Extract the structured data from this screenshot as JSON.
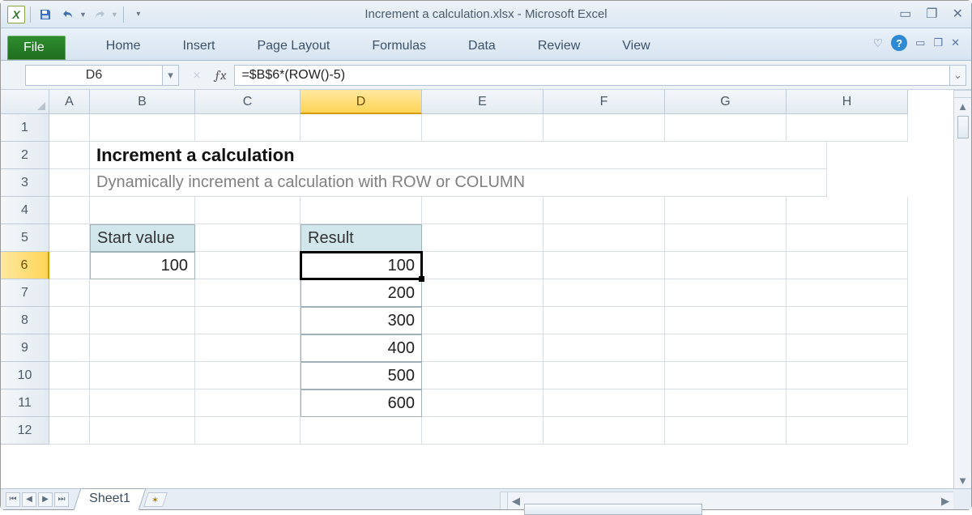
{
  "window": {
    "title": "Increment a calculation.xlsx  -  Microsoft Excel"
  },
  "ribbon": {
    "file": "File",
    "tabs": [
      "Home",
      "Insert",
      "Page Layout",
      "Formulas",
      "Data",
      "Review",
      "View"
    ]
  },
  "namebox": "D6",
  "formula": "=$B$6*(ROW()-5)",
  "columns": [
    "A",
    "B",
    "C",
    "D",
    "E",
    "F",
    "G",
    "H"
  ],
  "rows": [
    "1",
    "2",
    "3",
    "4",
    "5",
    "6",
    "7",
    "8",
    "9",
    "10",
    "11",
    "12"
  ],
  "selected": {
    "col": "D",
    "row": "6"
  },
  "content": {
    "title": "Increment a calculation",
    "subtitle": "Dynamically increment a calculation with ROW or COLUMN",
    "start_label": "Start value",
    "start_value": "100",
    "result_label": "Result",
    "results": [
      "100",
      "200",
      "300",
      "400",
      "500",
      "600"
    ]
  },
  "sheet_tab": "Sheet1",
  "colors": {
    "header_fill": "#d2e7ec",
    "file_tab": "#1e6d1e",
    "selected_header": "#ffd557"
  },
  "chart_data": {
    "type": "table",
    "title": "Increment a calculation",
    "columns": [
      "Start value",
      "Result"
    ],
    "rows": [
      [
        100,
        100
      ],
      [
        null,
        200
      ],
      [
        null,
        300
      ],
      [
        null,
        400
      ],
      [
        null,
        500
      ],
      [
        null,
        600
      ]
    ]
  }
}
